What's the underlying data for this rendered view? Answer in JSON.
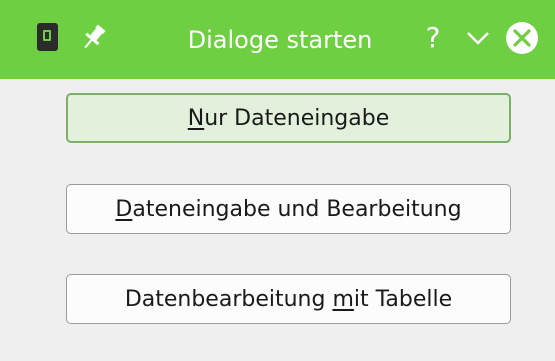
{
  "window": {
    "title": "Dialoge starten",
    "help_glyph": "?",
    "titlebar_color": "#6fcf43",
    "icons": [
      "document-app-icon",
      "pin-icon",
      "help-icon",
      "minimize-icon",
      "close-icon"
    ]
  },
  "buttons": [
    {
      "label": "Nur Dateneingabe",
      "mnemonic": "N",
      "focused": true
    },
    {
      "label": "Dateneingabe und Bearbeitung",
      "mnemonic": "D",
      "focused": false
    },
    {
      "label": "Datenbearbeitung mit Tabelle",
      "mnemonic": "m",
      "focused": false
    }
  ]
}
